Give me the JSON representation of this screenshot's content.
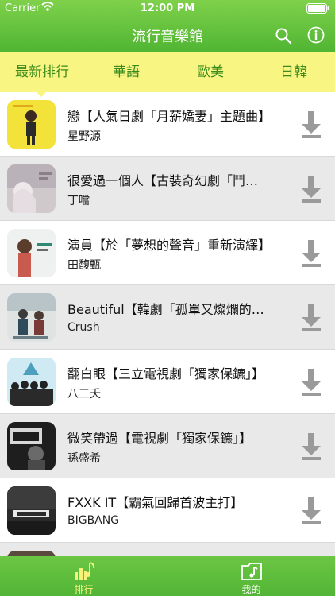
{
  "status_bar": {
    "carrier": "Carrier",
    "time": "12:00 PM",
    "icons": [
      "wifi-icon",
      "battery-icon"
    ]
  },
  "nav": {
    "title": "流行音樂館",
    "icons": [
      "search-icon",
      "info-icon"
    ]
  },
  "category_tabs": [
    {
      "label": "最新排行",
      "selected": true
    },
    {
      "label": "華語",
      "selected": false
    },
    {
      "label": "歐美",
      "selected": false
    },
    {
      "label": "日韓",
      "selected": false
    }
  ],
  "songs": [
    {
      "title": "戀【人氣日劇「月薪嬌妻」主題曲】",
      "artist": "星野源"
    },
    {
      "title": "很愛過一個人【古裝奇幻劇「鬥破蒼穹」】",
      "artist": "丁噹"
    },
    {
      "title": "演員【於「夢想的聲音」重新演繹】",
      "artist": "田馥甄"
    },
    {
      "title": "Beautiful【韓劇「孤單又燦爛的神」】",
      "artist": "Crush"
    },
    {
      "title": "翻白眼【三立電視劇「獨家保鑣」】",
      "artist": "八三夭"
    },
    {
      "title": "微笑帶過【電視劇「獨家保鑣」】",
      "artist": "孫盛希"
    },
    {
      "title": "FXXK IT【霸氣回歸首波主打】",
      "artist": "BIGBANG"
    }
  ],
  "bottom_tabs": [
    {
      "label": "排行",
      "icon": "chart-music-icon",
      "selected": true
    },
    {
      "label": "我的",
      "icon": "music-folder-icon",
      "selected": false
    }
  ],
  "colors": {
    "nav_green": "#5cbf37",
    "tab_yellow": "#f9f582",
    "tab_text_green": "#3a8a1c",
    "row_alt_gray": "#e9e9e9",
    "download_gray": "#9a9a9a"
  }
}
